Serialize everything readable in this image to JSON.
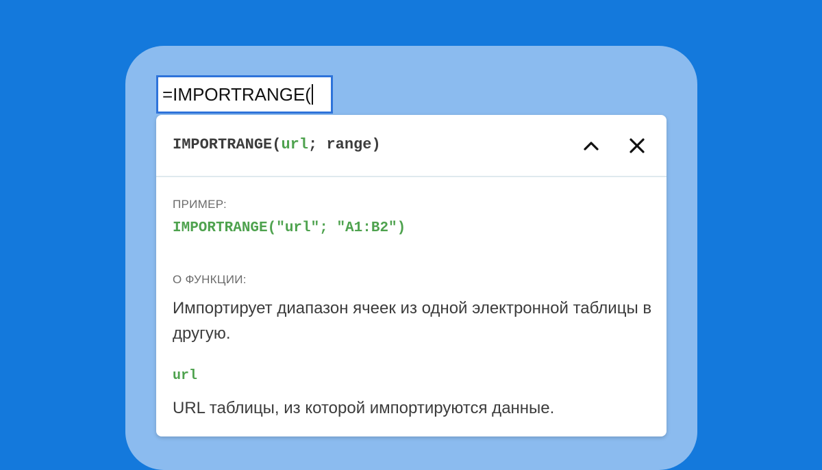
{
  "cell": {
    "formula": "=IMPORTRANGE("
  },
  "help_panel": {
    "signature": {
      "function_name": "IMPORTRANGE",
      "open_paren": "(",
      "param1": "url",
      "separator": "; ",
      "param2": "range",
      "close_paren": ")"
    },
    "collapse_icon": "chevron-up-icon",
    "close_icon": "close-icon",
    "example": {
      "label": "ПРИМЕР:",
      "code": "IMPORTRANGE(\"url\"; \"A1:B2\")"
    },
    "about": {
      "label": "О ФУНКЦИИ:",
      "text": "Импортирует диапазон ячеек из одной электронной таблицы в другую."
    },
    "params": [
      {
        "name": "url",
        "description": "URL таблицы, из которой импортируются данные."
      }
    ]
  },
  "colors": {
    "background": "#1479dc",
    "frame": "#8bbbef",
    "cell_border": "#2e73da",
    "code_green": "#4ea24e",
    "text": "#3c3c3c"
  }
}
